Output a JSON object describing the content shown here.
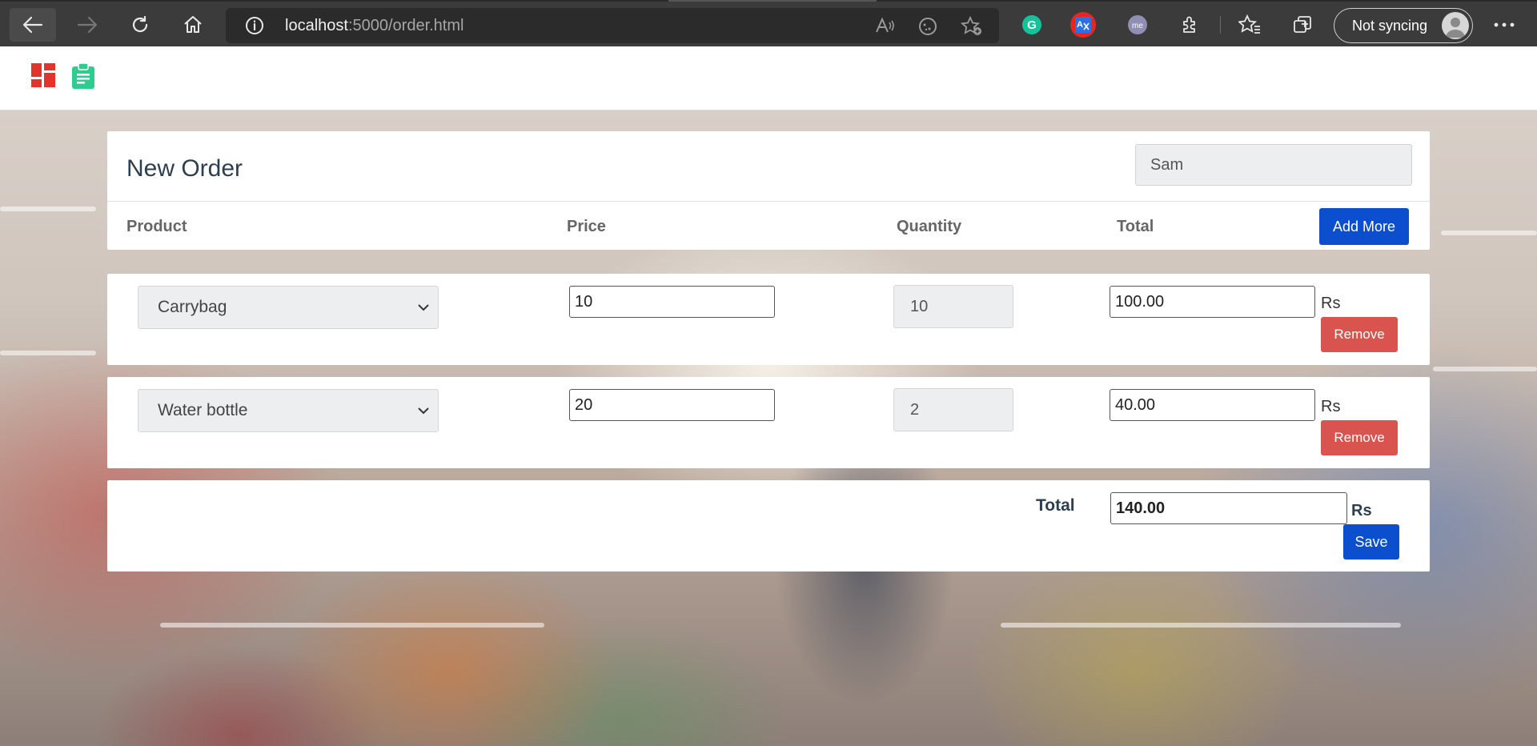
{
  "browser": {
    "url_host": "localhost",
    "url_path": ":5000/order.html",
    "sync_label": "Not syncing"
  },
  "colors": {
    "primary": "#0b4fcf",
    "danger": "#d9534f",
    "dashboard_icon": "#e2332c",
    "order_icon": "#2ecc8f"
  },
  "page": {
    "title": "New Order",
    "customer_name": "Sam",
    "columns": {
      "product": "Product",
      "price": "Price",
      "quantity": "Quantity",
      "total": "Total"
    },
    "add_more_label": "Add More",
    "currency": "Rs",
    "remove_label": "Remove",
    "items": [
      {
        "product": "Carrybag",
        "price": "10",
        "quantity": "10",
        "total": "100.00"
      },
      {
        "product": "Water bottle",
        "price": "20",
        "quantity": "2",
        "total": "40.00"
      }
    ],
    "grand_total_label": "Total",
    "grand_total": "140.00",
    "save_label": "Save"
  }
}
